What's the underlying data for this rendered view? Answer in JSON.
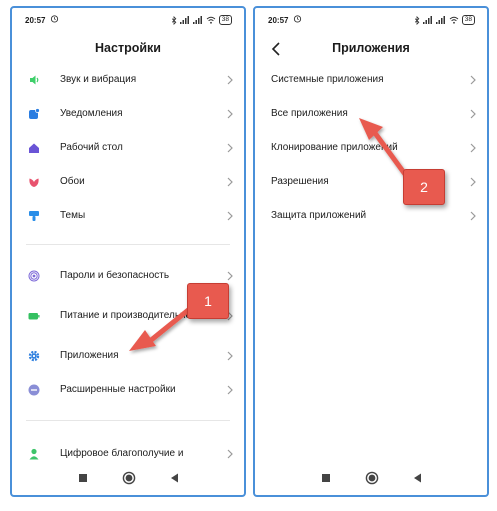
{
  "status": {
    "time": "20:57",
    "battery": "38"
  },
  "left_screen": {
    "title": "Настройки",
    "group1": [
      {
        "label": "Звук и вибрация",
        "icon": "speaker-icon",
        "color": "#3ecf6a"
      },
      {
        "label": "Уведомления",
        "icon": "notification-icon",
        "color": "#2a7de1"
      },
      {
        "label": "Рабочий стол",
        "icon": "home-icon",
        "color": "#6a54d6"
      },
      {
        "label": "Обои",
        "icon": "flower-icon",
        "color": "#e8536e"
      },
      {
        "label": "Темы",
        "icon": "brush-icon",
        "color": "#2a8ee8"
      }
    ],
    "group2": [
      {
        "label": "Пароли и безопасность",
        "icon": "fingerprint-icon",
        "color": "#7e6ad8"
      },
      {
        "label": "Питание и производительность",
        "icon": "battery-icon",
        "color": "#34c060"
      },
      {
        "label": "Приложения",
        "icon": "gear-icon",
        "color": "#2e7fde"
      },
      {
        "label": "Расширенные настройки",
        "icon": "more-icon",
        "color": "#8a8ed6"
      }
    ],
    "group3": [
      {
        "label": "Цифровое благополучие и",
        "icon": "person-icon",
        "color": "#3ec46a"
      }
    ]
  },
  "right_screen": {
    "title": "Приложения",
    "items": [
      {
        "label": "Системные приложения"
      },
      {
        "label": "Все приложения"
      },
      {
        "label": "Клонирование приложений"
      },
      {
        "label": "Разрешения"
      },
      {
        "label": "Защита приложений"
      }
    ]
  },
  "annotations": {
    "badge1": "1",
    "badge2": "2",
    "arrow_color": "#e85a4f"
  }
}
